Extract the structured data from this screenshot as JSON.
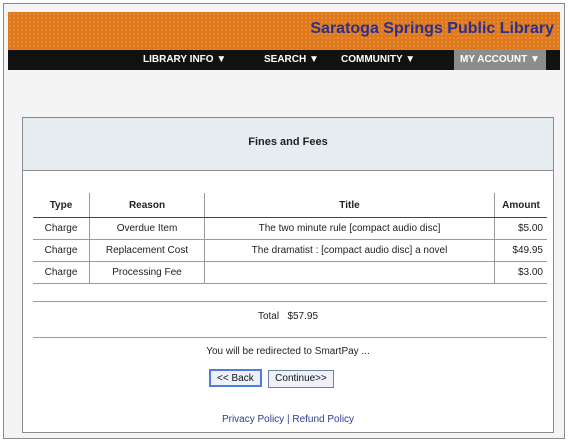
{
  "header": {
    "site_title": "Saratoga Springs Public Library",
    "colors": {
      "banner": "#e0791a",
      "title": "#2b2f8e",
      "nav": "#111111"
    }
  },
  "nav": {
    "items": [
      {
        "label": "LIBRARY INFO ▼"
      },
      {
        "label": "SEARCH ▼"
      },
      {
        "label": "COMMUNITY ▼"
      },
      {
        "label": "MY ACCOUNT ▼",
        "active": true
      }
    ]
  },
  "panel": {
    "title": "Fines and Fees",
    "table": {
      "headers": [
        "Type",
        "Reason",
        "Title",
        "Amount"
      ],
      "rows": [
        [
          "Charge",
          "Overdue Item",
          "The two minute rule [compact audio disc]",
          "$5.00"
        ],
        [
          "Charge",
          "Replacement Cost",
          "The dramatist : [compact audio disc] a novel",
          "$49.95"
        ],
        [
          "Charge",
          "Processing Fee",
          "",
          "$3.00"
        ]
      ]
    },
    "total_label": "Total",
    "total_value": "$57.95",
    "redirect_text": "You will be redirected to SmartPay ...",
    "back_button": "<< Back",
    "continue_button": "Continue>>",
    "footer": {
      "privacy": "Privacy Policy",
      "separator": "|",
      "refund": "Refund Policy"
    }
  }
}
